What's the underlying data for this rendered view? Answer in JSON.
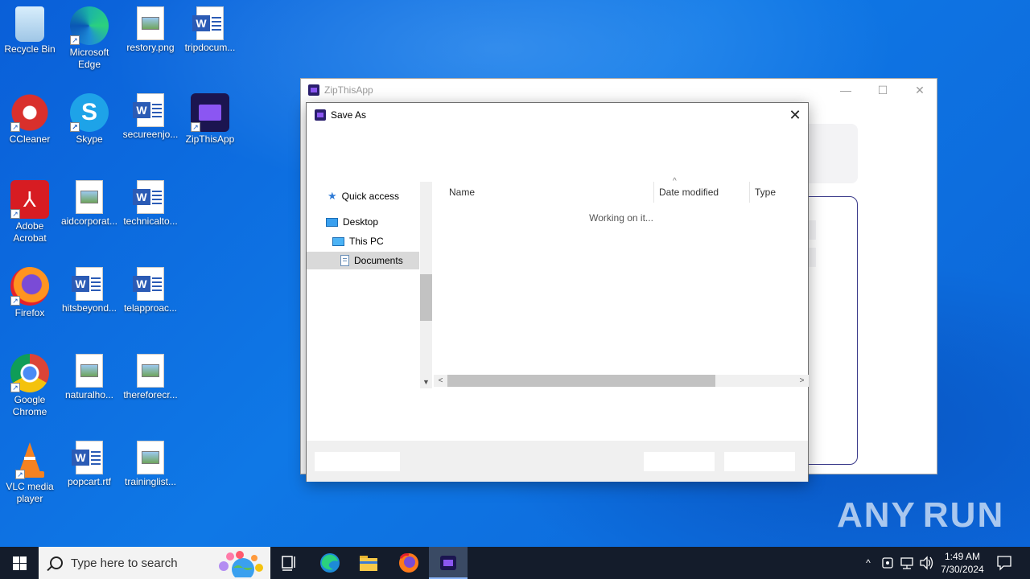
{
  "desktop": {
    "icons": [
      {
        "label": "Recycle Bin"
      },
      {
        "label": "Microsoft Edge"
      },
      {
        "label": "restory.png"
      },
      {
        "label": "tripdocum..."
      },
      {
        "label": "CCleaner"
      },
      {
        "label": "Skype"
      },
      {
        "label": "secureenjo..."
      },
      {
        "label": "ZipThisApp"
      },
      {
        "label": "Adobe Acrobat"
      },
      {
        "label": "aidcorporat..."
      },
      {
        "label": "technicalto..."
      },
      {
        "label": "Firefox"
      },
      {
        "label": "hitsbeyond..."
      },
      {
        "label": "telapproac..."
      },
      {
        "label": "Google Chrome"
      },
      {
        "label": "naturalho..."
      },
      {
        "label": "thereforecr..."
      },
      {
        "label": "VLC media player"
      },
      {
        "label": "popcart.rtf"
      },
      {
        "label": "traininglist..."
      }
    ]
  },
  "app_window": {
    "title": "ZipThisApp",
    "minimize": "—",
    "maximize": "☐",
    "close": "✕"
  },
  "dialog": {
    "title": "Save As",
    "close": "✕",
    "nav": {
      "quick_access": "Quick access",
      "desktop": "Desktop",
      "this_pc": "This PC",
      "documents": "Documents"
    },
    "columns": {
      "name": "Name",
      "date_modified": "Date modified",
      "type": "Type"
    },
    "status": "Working on it..."
  },
  "watermark": {
    "left": "ANY",
    "right": "RUN"
  },
  "taskbar": {
    "search_placeholder": "Type here to search",
    "time": "1:49 AM",
    "date": "7/30/2024"
  },
  "colors": {
    "desktop_bg": "#0a5fd8",
    "taskbar_bg": "#141c2b",
    "app_accent": "#8b56f2"
  }
}
